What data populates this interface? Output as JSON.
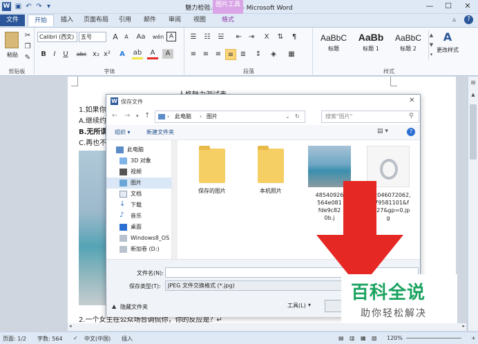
{
  "window": {
    "title": "魅力检验.docx.doc - Microsoft Word",
    "context_tab_group": "图片工具"
  },
  "tabs": [
    "文件",
    "开始",
    "插入",
    "页面布局",
    "引用",
    "邮件",
    "审阅",
    "视图",
    "格式"
  ],
  "ribbon": {
    "clipboard": {
      "label": "剪贴板",
      "paste": "粘贴"
    },
    "font": {
      "label": "字体",
      "font_name": "Calibri (西文)",
      "font_size": "五号",
      "bold": "B",
      "italic": "I",
      "underline": "U",
      "strike": "abc",
      "sub": "x₂",
      "sup": "x²",
      "grow": "A",
      "shrink": "A",
      "clear": "Aa",
      "phonetic": "wén",
      "border_char": "A"
    },
    "paragraph": {
      "label": "段落"
    },
    "styles": {
      "label": "样式",
      "items": [
        {
          "preview": "AaBbC",
          "name": "标题"
        },
        {
          "preview": "AaBb",
          "name": "标题 1"
        },
        {
          "preview": "AaBbC",
          "name": "标题 2"
        }
      ],
      "change": "更改样式"
    }
  },
  "document": {
    "heading": "人格魅力测试表",
    "lines": [
      "1.如果你",
      "A.继续约",
      "B.无所谓",
      "C.再也不",
      "2.一个女生在公众场合调侃你，你的反应是？↵"
    ]
  },
  "dialog": {
    "title": "保存文件",
    "breadcrumb": [
      "此电脑",
      "图片"
    ],
    "search_placeholder": "搜索\"图片\"",
    "organize": "组织 ▾",
    "new_folder": "新建文件夹",
    "nav": [
      {
        "label": "此电脑"
      },
      {
        "label": "3D 对象"
      },
      {
        "label": "视频"
      },
      {
        "label": "图片"
      },
      {
        "label": "文档"
      },
      {
        "label": "下载"
      },
      {
        "label": "音乐"
      },
      {
        "label": "桌面"
      },
      {
        "label": "Windows8_OS"
      },
      {
        "label": "新加卷 (D:)"
      }
    ],
    "files": [
      {
        "name": "保存的图片",
        "kind": "folder"
      },
      {
        "name": "本机照片",
        "kind": "folder"
      },
      {
        "name": "48540926\n564e081\nfde9c82\n0b.j",
        "kind": "photo"
      },
      {
        "name": "u=2046072062,\n3479581101&f\nm=27&gp=0.jp\ng",
        "kind": "ring"
      }
    ],
    "filename_label": "文件名(N):",
    "filename_value": "",
    "filetype_label": "保存类型(T):",
    "filetype_value": "JPEG 文件交换格式 (*.jpg)",
    "hide_folders": "隐藏文件夹",
    "tools": "工具(L)",
    "save": "保"
  },
  "status": {
    "page": "页面: 1/2",
    "words": "字数: 564",
    "lang": "中文(中国)",
    "mode": "插入",
    "zoom": "120%"
  },
  "watermark": {
    "title": "百科全说",
    "subtitle": "助你轻松解决"
  }
}
